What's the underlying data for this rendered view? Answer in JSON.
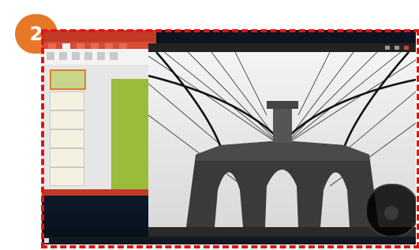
{
  "step_badge": "2",
  "powerpoint": {
    "title": "",
    "slide_count": 7
  },
  "photo_viewer": {
    "title": "",
    "bottom_bar": "",
    "dial_label": ""
  },
  "taskbar": {
    "text": ""
  },
  "colors": {
    "badge": "#e7782a",
    "dashed_border": "#e01515",
    "ppt_red": "#c23a26",
    "slide_green": "#9bbb3a"
  },
  "icons": [
    "start-icon",
    "window-minimize-icon",
    "window-maximize-icon",
    "window-close-icon",
    "dial-icon"
  ]
}
